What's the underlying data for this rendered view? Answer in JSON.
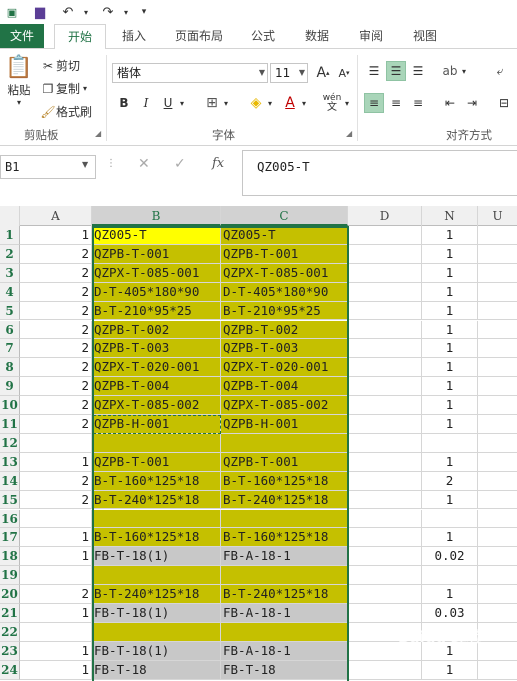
{
  "qat": {
    "undo_label": "↶",
    "redo_label": "↷",
    "more_label": "▾"
  },
  "tabs": [
    "文件",
    "开始",
    "插入",
    "页面布局",
    "公式",
    "数据",
    "审阅",
    "视图"
  ],
  "ribbon": {
    "paste": "粘贴",
    "cut": "剪切",
    "copy": "复制",
    "format_painter": "格式刷",
    "clipboard_group": "剪贴板",
    "font_name": "楷体",
    "font_size": "11",
    "font_group": "字体",
    "align_group": "对齐方式",
    "bold": "B",
    "italic": "I",
    "underline": "U",
    "wen": "wén"
  },
  "formula_bar": {
    "name_box": "B1",
    "fx": "fx",
    "content": "QZ005-T",
    "cancel": "✕",
    "enter": "✓"
  },
  "columns": [
    "A",
    "B",
    "C",
    "D",
    "N",
    "U"
  ],
  "rows": [
    {
      "n": "1",
      "a": "1",
      "b": "QZ005-T",
      "c": "QZ005-T",
      "nval": "1"
    },
    {
      "n": "2",
      "a": "2",
      "b": "QZPB-T-001",
      "c": "QZPB-T-001",
      "nval": "1"
    },
    {
      "n": "3",
      "a": "2",
      "b": "QZPX-T-085-001",
      "c": "QZPX-T-085-001",
      "nval": "1"
    },
    {
      "n": "4",
      "a": "2",
      "b": "D-T-405*180*90",
      "c": "D-T-405*180*90",
      "nval": "1"
    },
    {
      "n": "5",
      "a": "2",
      "b": "B-T-210*95*25",
      "c": "B-T-210*95*25",
      "nval": "1"
    },
    {
      "n": "6",
      "a": "2",
      "b": "QZPB-T-002",
      "c": "QZPB-T-002",
      "nval": "1"
    },
    {
      "n": "7",
      "a": "2",
      "b": "QZPB-T-003",
      "c": "QZPB-T-003",
      "nval": "1"
    },
    {
      "n": "8",
      "a": "2",
      "b": "QZPX-T-020-001",
      "c": "QZPX-T-020-001",
      "nval": "1"
    },
    {
      "n": "9",
      "a": "2",
      "b": "QZPB-T-004",
      "c": "QZPB-T-004",
      "nval": "1"
    },
    {
      "n": "10",
      "a": "2",
      "b": "QZPX-T-085-002",
      "c": "QZPX-T-085-002",
      "nval": "1"
    },
    {
      "n": "11",
      "a": "2",
      "b": "QZPB-H-001",
      "c": "QZPB-H-001",
      "nval": "1"
    },
    {
      "n": "12",
      "a": "",
      "b": "",
      "c": "",
      "nval": ""
    },
    {
      "n": "13",
      "a": "1",
      "b": "QZPB-T-001",
      "c": "QZPB-T-001",
      "nval": "1"
    },
    {
      "n": "14",
      "a": "2",
      "b": "B-T-160*125*18",
      "c": "B-T-160*125*18",
      "nval": "2"
    },
    {
      "n": "15",
      "a": "2",
      "b": "B-T-240*125*18",
      "c": "B-T-240*125*18",
      "nval": "1"
    },
    {
      "n": "16",
      "a": "",
      "b": "",
      "c": "",
      "nval": ""
    },
    {
      "n": "17",
      "a": "1",
      "b": "B-T-160*125*18",
      "c": "B-T-160*125*18",
      "nval": "1"
    },
    {
      "n": "18",
      "a": "1",
      "b": "FB-T-18(1)",
      "c": "FB-A-18-1",
      "nval": "0.02"
    },
    {
      "n": "19",
      "a": "",
      "b": "",
      "c": "",
      "nval": ""
    },
    {
      "n": "20",
      "a": "2",
      "b": "B-T-240*125*18",
      "c": "B-T-240*125*18",
      "nval": "1"
    },
    {
      "n": "21",
      "a": "1",
      "b": "FB-T-18(1)",
      "c": "FB-A-18-1",
      "nval": "0.03"
    },
    {
      "n": "22",
      "a": "",
      "b": "",
      "c": "",
      "nval": ""
    },
    {
      "n": "23",
      "a": "1",
      "b": "FB-T-18(1)",
      "c": "FB-A-18-1",
      "nval": "1"
    },
    {
      "n": "24",
      "a": "1",
      "b": "FB-T-18",
      "c": "FB-T-18",
      "nval": "1"
    }
  ],
  "watermark": "Baidu 经验",
  "colors": {
    "accent": "#217346",
    "highlight": "#c5c000",
    "gray_fill": "#c8c8c8",
    "yellow_fill": "#ffff00"
  }
}
